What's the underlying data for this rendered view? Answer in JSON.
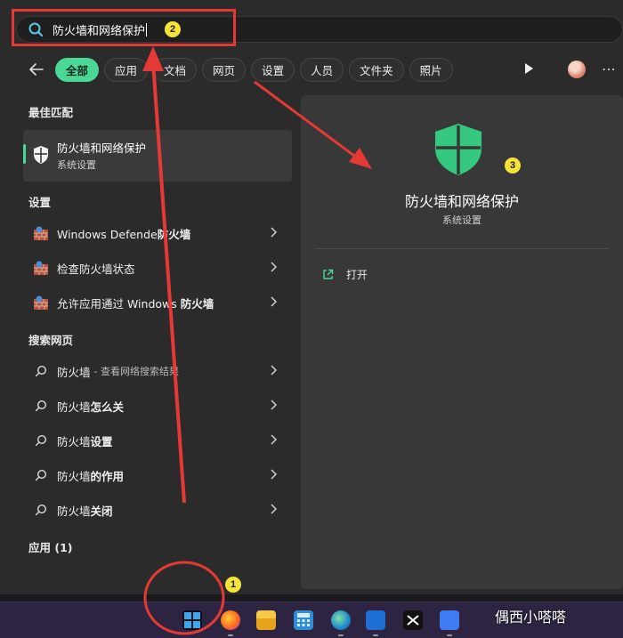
{
  "search": {
    "query": "防火墙和网络保护"
  },
  "filters": [
    {
      "label": "全部",
      "active": true
    },
    {
      "label": "应用"
    },
    {
      "label": "文档"
    },
    {
      "label": "网页"
    },
    {
      "label": "设置"
    },
    {
      "label": "人员"
    },
    {
      "label": "文件夹"
    },
    {
      "label": "照片"
    }
  ],
  "sections": {
    "best_match": "最佳匹配",
    "settings": "设置",
    "web": "搜索网页",
    "apps": "应用 (1)"
  },
  "best_match": {
    "title": "防火墙和网络保护",
    "subtitle": "系统设置"
  },
  "settings_items": [
    {
      "pre": "Windows Defende",
      "bold": "防火墙"
    },
    {
      "pre": "检查防火墙状态",
      "bold": ""
    },
    {
      "pre": "允许应用通过 Windows ",
      "bold": "防火墙"
    }
  ],
  "web_items": [
    {
      "pre": "防火墙",
      "hint": "- 查看网络搜索结果"
    },
    {
      "pre": "防火墙",
      "bold": "怎么关"
    },
    {
      "pre": "防火墙",
      "bold": "设置"
    },
    {
      "pre": "防火墙",
      "bold": "的作用"
    },
    {
      "pre": "防火墙",
      "bold": "关闭"
    }
  ],
  "detail": {
    "title": "防火墙和网络保护",
    "subtitle": "系统设置",
    "open_label": "打开"
  },
  "annotations": [
    "1",
    "2",
    "3"
  ],
  "watermark": "偶西小嗒嗒",
  "colors": {
    "accent": "#4bd796",
    "annotation": "#e53935",
    "badge": "#f5e33a"
  }
}
